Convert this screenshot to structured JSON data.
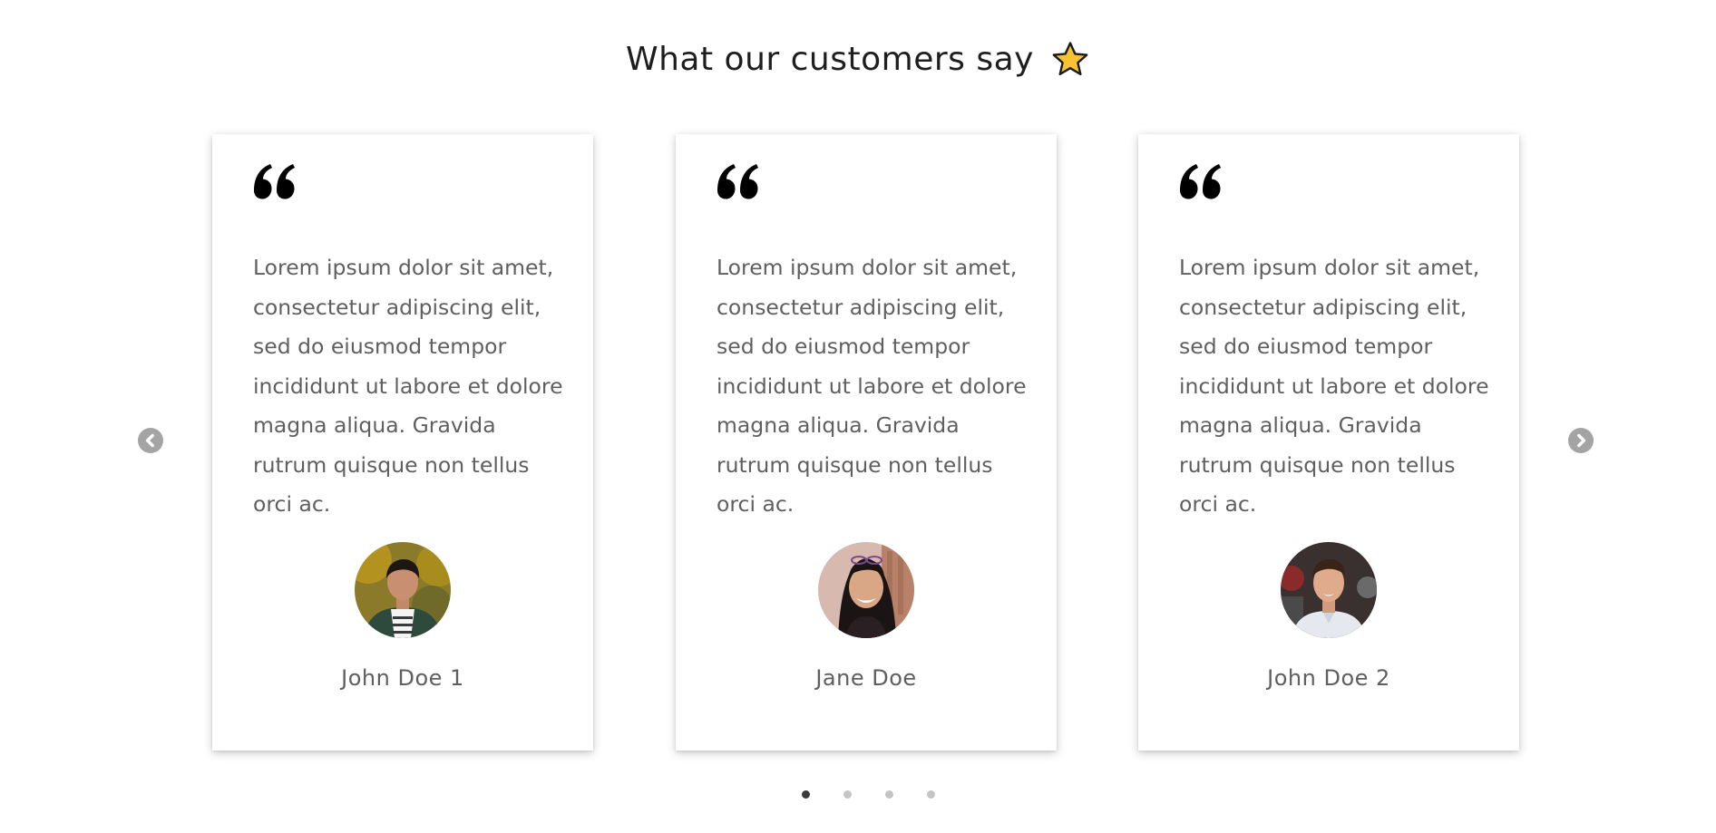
{
  "section": {
    "title": "What our customers say",
    "title_icon": "star-icon",
    "accent_color": "#F9C233"
  },
  "testimonials": [
    {
      "quote_icon": "quote-icon",
      "text": "Lorem ipsum dolor sit amet, consectetur adipiscing elit, sed do eiusmod tempor incididunt ut labore et dolore magna aliqua. Gravida rutrum quisque non tellus orci ac.",
      "name": "John Doe 1",
      "avatar": "avatar-photo-man-green-jacket"
    },
    {
      "quote_icon": "quote-icon",
      "text": "Lorem ipsum dolor sit amet, consectetur adipiscing elit, sed do eiusmod tempor incididunt ut labore et dolore magna aliqua. Gravida rutrum quisque non tellus orci ac.",
      "name": "Jane Doe",
      "avatar": "avatar-photo-woman-smiling"
    },
    {
      "quote_icon": "quote-icon",
      "text": "Lorem ipsum dolor sit amet, consectetur adipiscing elit, sed do eiusmod tempor incididunt ut labore et dolore magna aliqua. Gravida rutrum quisque non tellus orci ac.",
      "name": "John Doe 2",
      "avatar": "avatar-photo-man-white-shirt"
    }
  ],
  "carousel": {
    "prev_icon": "chevron-left-circle-icon",
    "next_icon": "chevron-right-circle-icon",
    "dots_count": 4,
    "active_dot": 1
  }
}
